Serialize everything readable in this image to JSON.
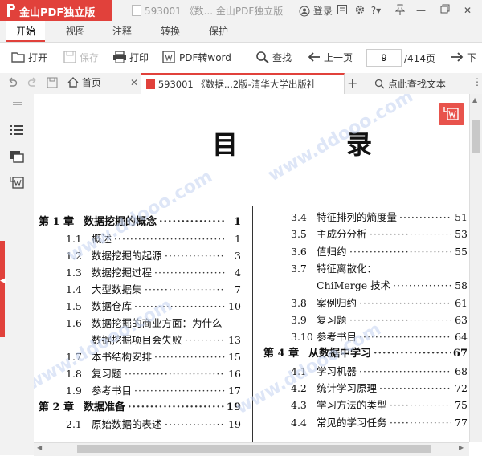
{
  "app": {
    "name": "金山PDF独立版",
    "window_title": "593001 《数... 金山PDF独立版",
    "login_label": "登录",
    "accent": "#e1413b"
  },
  "menu": {
    "tabs": [
      "开始",
      "视图",
      "注释",
      "转换",
      "保护"
    ],
    "active_tab": "开始"
  },
  "toolbar": {
    "open": "打开",
    "save": "保存",
    "print": "打印",
    "pdf_to_word": "PDF转word",
    "find": "查找",
    "prev_page": "上一页",
    "next_page": "下",
    "current_page": "9",
    "total_pages": "/414页"
  },
  "tabs": {
    "home": "首页",
    "doc": "593001 《数据...2版-清华大学出版社",
    "search_text": "点此查找文本"
  },
  "page": {
    "title": "目  录",
    "left_entries": [
      {
        "num": "第 1 章",
        "title": "数据挖掘的概念",
        "page": "1",
        "chapter": true
      },
      {
        "num": "1.1",
        "title": "概述",
        "page": "1"
      },
      {
        "num": "1.2",
        "title": "数据挖掘的起源",
        "page": "3"
      },
      {
        "num": "1.3",
        "title": "数据挖掘过程",
        "page": "4"
      },
      {
        "num": "1.4",
        "title": "大型数据集",
        "page": "7"
      },
      {
        "num": "1.5",
        "title": "数据仓库",
        "page": "10"
      },
      {
        "num": "1.6",
        "title": "数据挖掘的商业方面：为什么",
        "page": ""
      },
      {
        "num": "",
        "title": "数据挖掘项目会失败",
        "page": "13"
      },
      {
        "num": "1.7",
        "title": "本书结构安排",
        "page": "15"
      },
      {
        "num": "1.8",
        "title": "复习题",
        "page": "16"
      },
      {
        "num": "1.9",
        "title": "参考书目",
        "page": "17"
      },
      {
        "num": "第 2 章",
        "title": "数据准备",
        "page": "19",
        "chapter": true
      },
      {
        "num": "2.1",
        "title": "原始数据的表述",
        "page": "19"
      }
    ],
    "right_entries": [
      {
        "num": "3.4",
        "title": "特征排列的熵度量",
        "page": "51"
      },
      {
        "num": "3.5",
        "title": "主成分分析",
        "page": "53"
      },
      {
        "num": "3.6",
        "title": "值归约",
        "page": "55"
      },
      {
        "num": "3.7",
        "title": "特征离散化：",
        "page": ""
      },
      {
        "num": "",
        "title": "ChiMerge 技术",
        "page": "58"
      },
      {
        "num": "3.8",
        "title": "案例归约",
        "page": "61"
      },
      {
        "num": "3.9",
        "title": "复习题",
        "page": "63"
      },
      {
        "num": "3.10",
        "title": "参考书目",
        "page": "64"
      },
      {
        "num": "第 4 章",
        "title": "从数据中学习",
        "page": "67",
        "chapter": true
      },
      {
        "num": "4.1",
        "title": "学习机器",
        "page": "68"
      },
      {
        "num": "4.2",
        "title": "统计学习原理",
        "page": "72"
      },
      {
        "num": "4.3",
        "title": "学习方法的类型",
        "page": "75"
      },
      {
        "num": "4.4",
        "title": "常见的学习任务",
        "page": "77"
      }
    ],
    "watermark": "www.ddooo.com"
  }
}
